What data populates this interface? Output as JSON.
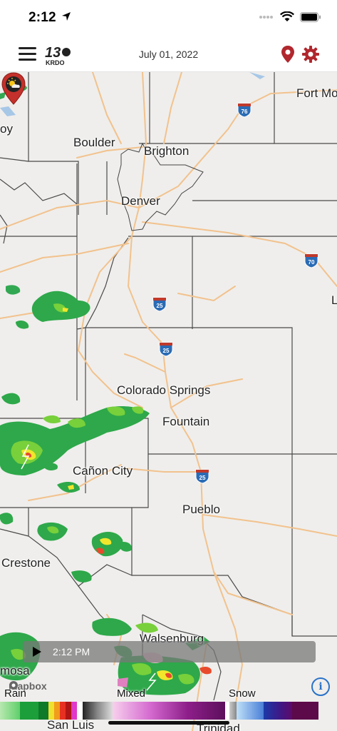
{
  "status_bar": {
    "time": "2:12"
  },
  "header": {
    "logo_number": "13",
    "logo_text": "KRDO",
    "date": "July 01, 2022"
  },
  "map": {
    "cities": [
      {
        "name": "Fort Mo"
      },
      {
        "name": "Boulder"
      },
      {
        "name": "Brighton"
      },
      {
        "name": "Denver"
      },
      {
        "name": "Colorado Springs"
      },
      {
        "name": "Fountain"
      },
      {
        "name": "Cañon City"
      },
      {
        "name": "Pueblo"
      },
      {
        "name": "Crestone"
      },
      {
        "name": "Walsenburg"
      },
      {
        "name": "mosa"
      },
      {
        "name": "San Luis"
      },
      {
        "name": "Trinidad"
      },
      {
        "name": "oy"
      },
      {
        "name": "L"
      }
    ],
    "highways": [
      {
        "number": "76"
      },
      {
        "number": "70"
      },
      {
        "number": "25"
      },
      {
        "number": "25"
      },
      {
        "number": "25"
      }
    ],
    "attribution": "mapbox"
  },
  "timeline": {
    "time": "2:12 PM"
  },
  "legend": {
    "rain": "Rain",
    "mixed": "Mixed",
    "snow": "Snow"
  },
  "colors": {
    "accent": "#b0272d",
    "interstate": "#2a6bb5",
    "road": "#f0c088"
  }
}
